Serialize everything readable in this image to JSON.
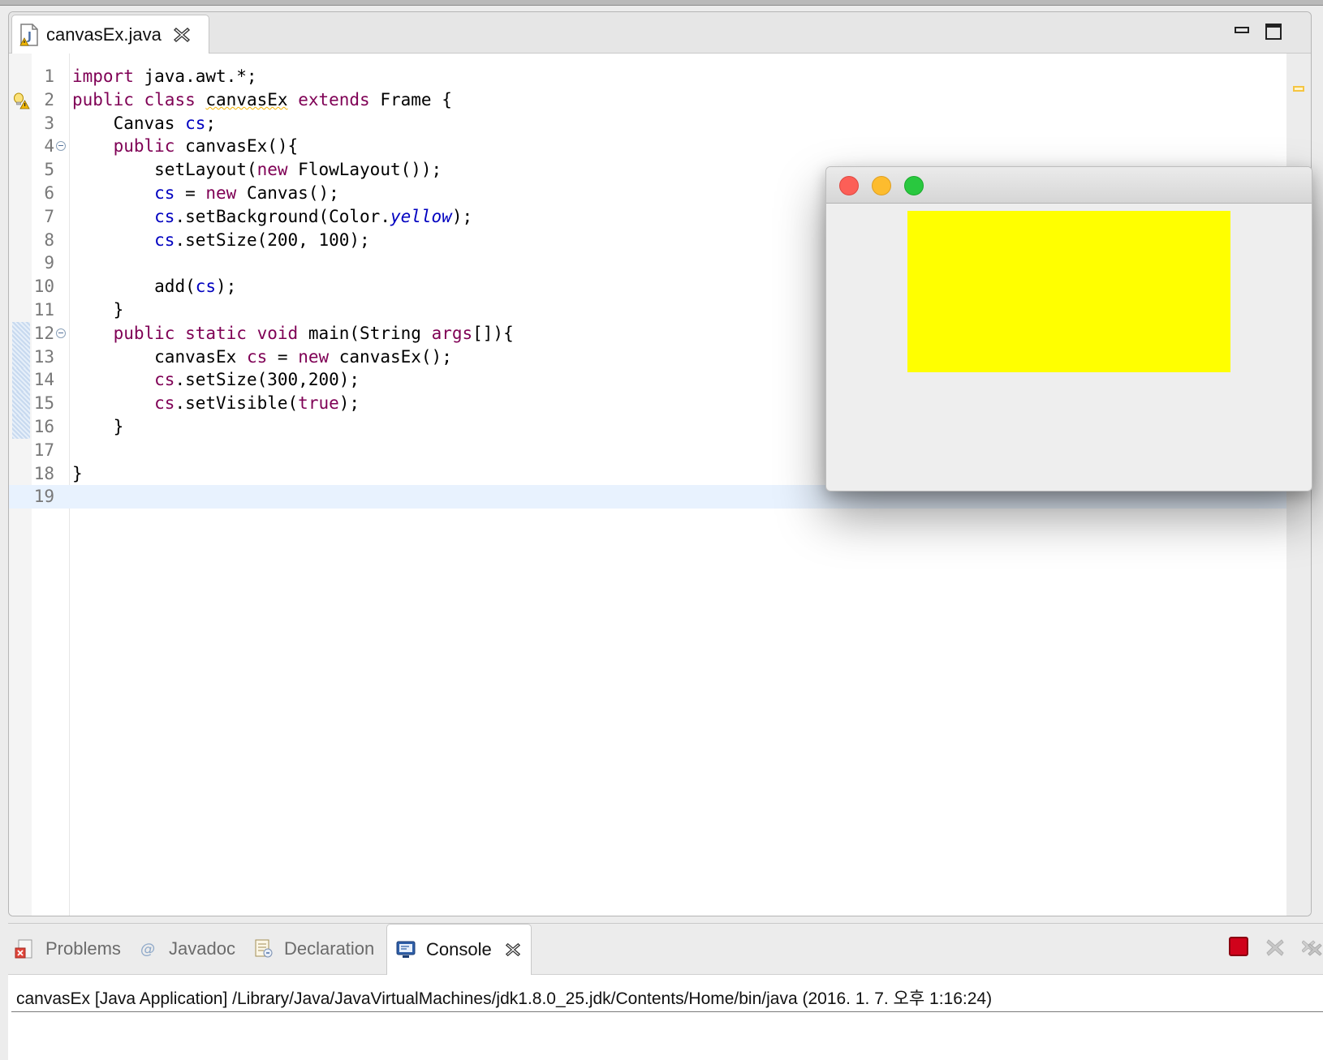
{
  "editor": {
    "tab_title": "canvasEx.java",
    "lines": [
      {
        "n": "1"
      },
      {
        "n": "2"
      },
      {
        "n": "3"
      },
      {
        "n": "4"
      },
      {
        "n": "5"
      },
      {
        "n": "6"
      },
      {
        "n": "7"
      },
      {
        "n": "8"
      },
      {
        "n": "9"
      },
      {
        "n": "10"
      },
      {
        "n": "11"
      },
      {
        "n": "12"
      },
      {
        "n": "13"
      },
      {
        "n": "14"
      },
      {
        "n": "15"
      },
      {
        "n": "16"
      },
      {
        "n": "17"
      },
      {
        "n": "18"
      },
      {
        "n": "19"
      }
    ],
    "code": {
      "import_kw": "import",
      "import_pkg": " java.awt.*;",
      "public": "public",
      "class": "class",
      "extends": "extends",
      "new": "new",
      "static": "static",
      "void": "void",
      "true": "true",
      "class_name": "canvasEx",
      "frame_brace": " Frame {",
      "canvas_type": "Canvas ",
      "cs": "cs",
      "semicolon": ";",
      "ctor_sig": " canvasEx(){",
      "set_layout": "setLayout(",
      "flow_layout": " FlowLayout());",
      "assign": " = ",
      "canvas_ctor": " Canvas();",
      "set_bg": ".setBackground(Color.",
      "yellow": "yellow",
      "close_paren": ");",
      "set_size_200": ".setSize(200, 100);",
      "add_open": "add(",
      "close_brace": "}",
      "main_sig": " main(String ",
      "args": "args",
      "main_end": "[]){",
      "local_type": "canvasEx ",
      "local_ctor": " canvasEx();",
      "set_size_300": ".setSize(300,200);",
      "set_visible": ".setVisible("
    }
  },
  "console": {
    "tabs": {
      "problems": "Problems",
      "javadoc": "Javadoc",
      "declaration": "Declaration",
      "console": "Console"
    },
    "header": "canvasEx [Java Application] /Library/Java/JavaVirtualMachines/jdk1.8.0_25.jdk/Contents/Home/bin/java (2016. 1. 7. 오후 1:16:24)"
  },
  "app_window": {
    "canvas_color": "#ffff00"
  },
  "colors": {
    "keyword": "#7f0055",
    "field": "#0000c0",
    "current_line": "#e8f2fe",
    "terminate": "#d0021b"
  },
  "icons": [
    "java-file-icon",
    "close-tab-icon",
    "minimize-icon",
    "maximize-icon",
    "warning-lightbulb-icon",
    "fold-icon",
    "problems-icon",
    "javadoc-icon",
    "declaration-icon",
    "console-icon",
    "terminate-icon",
    "remove-launch-icon",
    "remove-all-icon"
  ]
}
